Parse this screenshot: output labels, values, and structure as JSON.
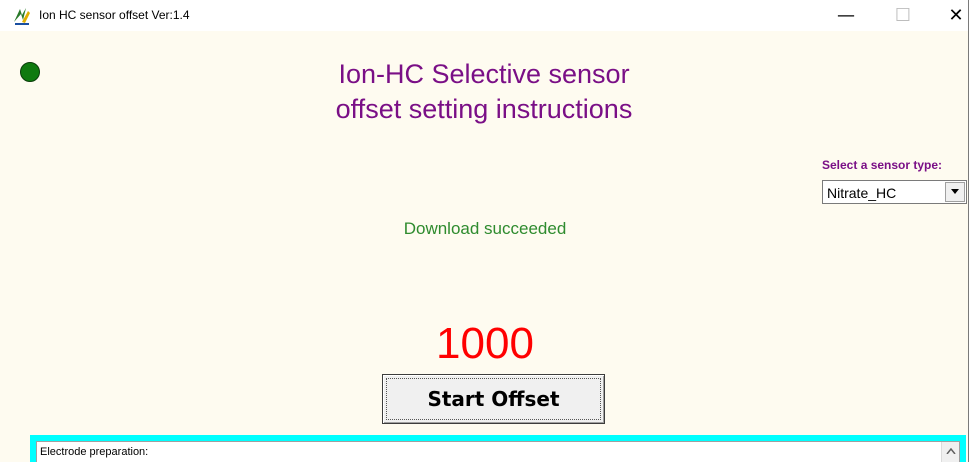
{
  "window": {
    "title": "Ion HC sensor offset  Ver:1.4",
    "icon": "app-logo-icon",
    "controls": {
      "minimize_icon": "minimize-icon",
      "minimize": "—",
      "maximize_icon": "maximize-icon",
      "maximize": "☐",
      "close_icon": "close-icon",
      "close": "✕"
    }
  },
  "status_led": {
    "color": "#0f7a0f"
  },
  "heading": {
    "line1": "Ion-HC Selective sensor",
    "line2": "offset setting instructions",
    "color": "#7a0f86"
  },
  "sensor": {
    "label": "Select a sensor type:",
    "selected": "Nitrate_HC",
    "arrow_icon": "chevron-down-icon"
  },
  "status": {
    "message": "Download succeeded",
    "color": "#2e8b2e"
  },
  "counter": {
    "value": "1000",
    "color": "#ff0000"
  },
  "start_button": {
    "label": "Start Offset"
  },
  "instructions": {
    "text": "Electrode preparation:",
    "frame_color": "#00ffff",
    "scroll_icon": "scroll-up-icon"
  }
}
